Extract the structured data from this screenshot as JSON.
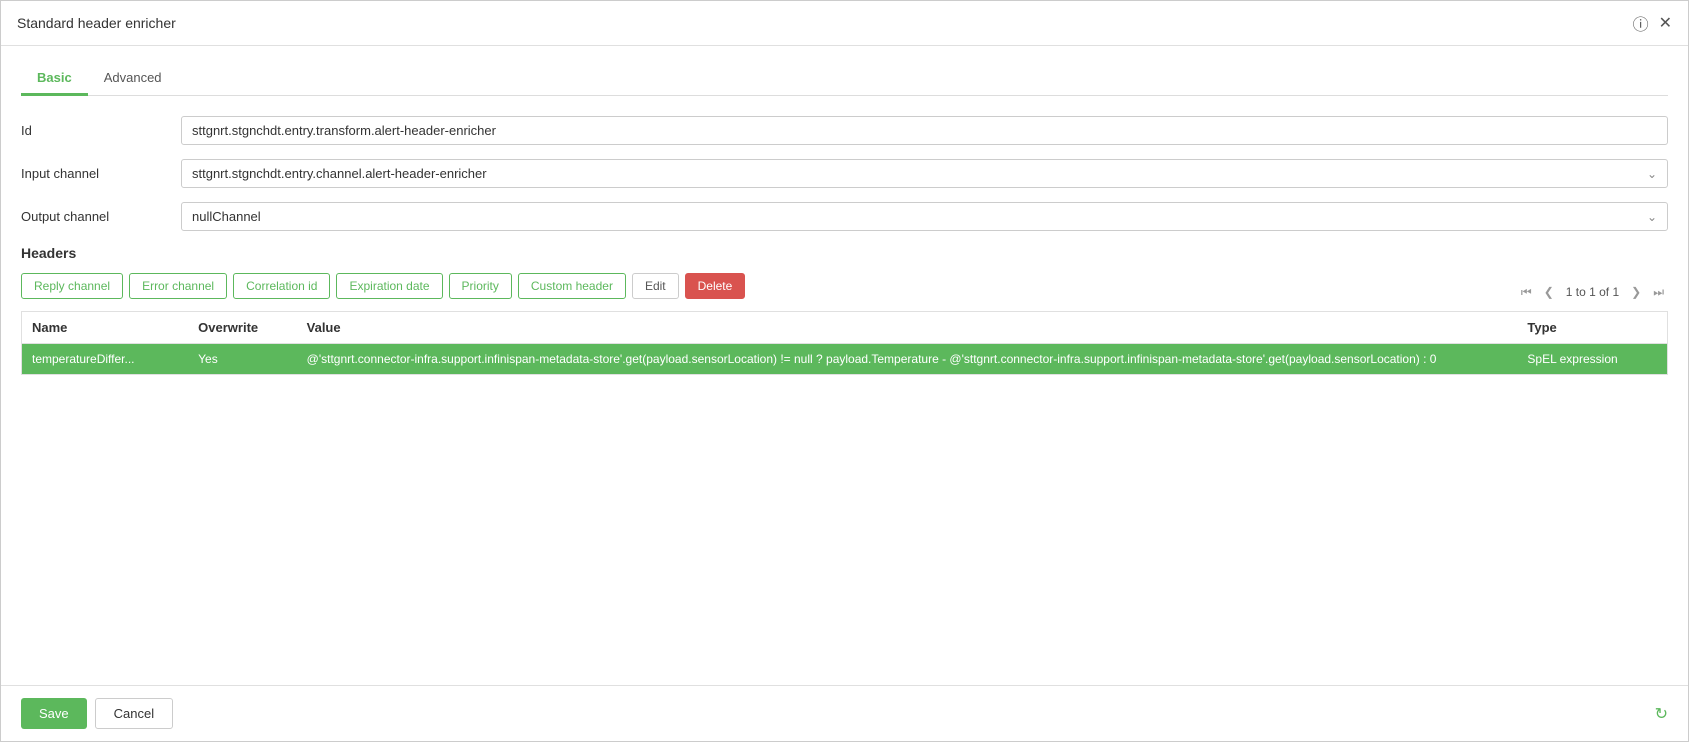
{
  "dialog": {
    "title": "Standard header enricher"
  },
  "tabs": [
    {
      "label": "Basic",
      "active": true
    },
    {
      "label": "Advanced",
      "active": false
    }
  ],
  "form": {
    "id_label": "Id",
    "id_value": "sttgnrt.stgnchdt.entry.transform.alert-header-enricher",
    "input_channel_label": "Input channel",
    "input_channel_value": "sttgnrt.stgnchdt.entry.channel.alert-header-enricher",
    "output_channel_label": "Output channel",
    "output_channel_value": "nullChannel"
  },
  "headers_section": {
    "title": "Headers",
    "buttons": [
      "Reply channel",
      "Error channel",
      "Correlation id",
      "Expiration date",
      "Priority",
      "Custom header",
      "Edit"
    ],
    "delete_btn": "Delete",
    "pagination": {
      "text": "1 to 1 of 1"
    }
  },
  "table": {
    "columns": [
      "Name",
      "Overwrite",
      "Value",
      "Type"
    ],
    "rows": [
      {
        "name": "temperatureDiffer...",
        "overwrite": "Yes",
        "value": "@'sttgnrt.connector-infra.support.infinispan-metadata-store'.get(payload.sensorLocation) != null ? payload.Temperature - @'sttgnrt.connector-infra.support.infinispan-metadata-store'.get(payload.sensorLocation) : 0",
        "type": "SpEL expression"
      }
    ]
  },
  "footer": {
    "save_label": "Save",
    "cancel_label": "Cancel"
  }
}
